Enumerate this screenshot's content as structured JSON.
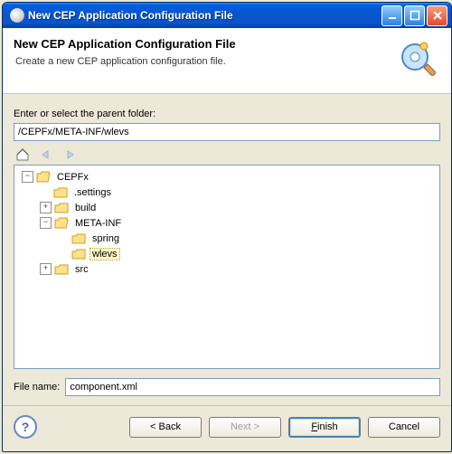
{
  "window": {
    "title": "New CEP Application Configuration File"
  },
  "banner": {
    "heading": "New CEP Application Configuration File",
    "subtext": "Create a new CEP application configuration file."
  },
  "body": {
    "parent_label": "Enter or select the parent folder:",
    "parent_path": "/CEPFx/META-INF/wlevs"
  },
  "tree": {
    "root": "CEPFx",
    "items": [
      {
        "name": ".settings",
        "depth": 2,
        "expandable": false
      },
      {
        "name": "build",
        "depth": 2,
        "expandable": true,
        "expanded": false
      },
      {
        "name": "META-INF",
        "depth": 2,
        "expandable": true,
        "expanded": true
      },
      {
        "name": "spring",
        "depth": 3,
        "expandable": false
      },
      {
        "name": "wlevs",
        "depth": 3,
        "expandable": false,
        "selected": true
      },
      {
        "name": "src",
        "depth": 2,
        "expandable": true,
        "expanded": false
      }
    ]
  },
  "file": {
    "label": "File name:",
    "value": "component.xml"
  },
  "buttons": {
    "back": "< Back",
    "next": "Next >",
    "finish": "Finish",
    "cancel": "Cancel"
  }
}
